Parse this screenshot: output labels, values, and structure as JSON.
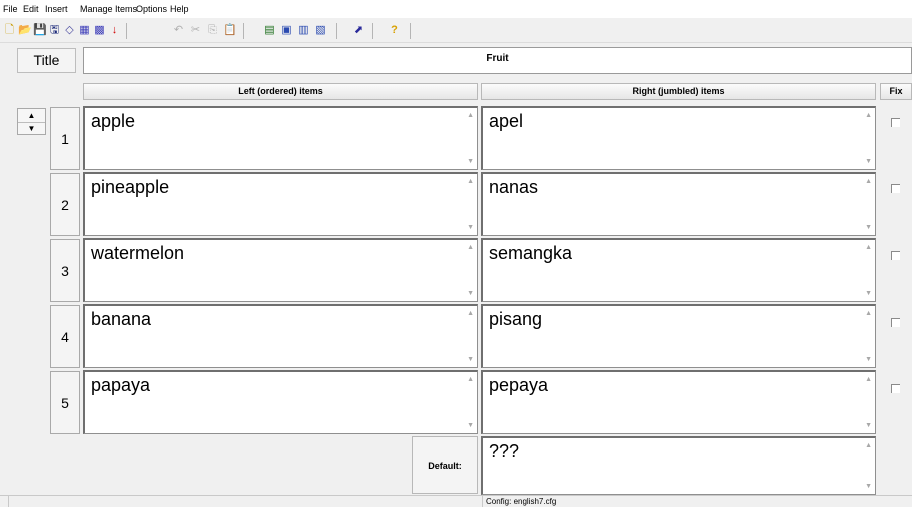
{
  "menu": [
    "File",
    "Edit",
    "Insert",
    "Manage Items",
    "Options",
    "Help"
  ],
  "toolbar_icons": [
    {
      "name": "new-file-icon",
      "glyph": "🗋"
    },
    {
      "name": "open-folder-icon",
      "glyph": "📂"
    },
    {
      "name": "save-icon",
      "glyph": "💾"
    },
    {
      "name": "save-as-icon",
      "glyph": "🖫"
    },
    {
      "name": "eraser-icon",
      "glyph": "◇"
    },
    {
      "name": "shuffle-icon",
      "glyph": "▦"
    },
    {
      "name": "shuffle-all-icon",
      "glyph": "▩"
    },
    {
      "name": "move-down-icon",
      "glyph": "↓"
    },
    {
      "name": "undo-icon",
      "glyph": "↶"
    },
    {
      "name": "cut-icon",
      "glyph": "✂"
    },
    {
      "name": "copy-icon",
      "glyph": "⎘"
    },
    {
      "name": "paste-icon",
      "glyph": "📋"
    },
    {
      "name": "add-items-icon",
      "glyph": "▤"
    },
    {
      "name": "clipboard-items-icon",
      "glyph": "▣"
    },
    {
      "name": "split-items-icon",
      "glyph": "▥"
    },
    {
      "name": "join-items-icon",
      "glyph": "▧"
    },
    {
      "name": "export-icon",
      "glyph": "⬈"
    },
    {
      "name": "help-icon",
      "glyph": "?"
    }
  ],
  "title_button": "Title",
  "title_value": "Fruit",
  "headers": {
    "left": "Left (ordered) items",
    "right": "Right (jumbled) items",
    "fix": "Fix"
  },
  "rows": [
    {
      "num": "1",
      "left": "apple",
      "right": "apel",
      "fix": false
    },
    {
      "num": "2",
      "left": "pineapple",
      "right": "nanas",
      "fix": false
    },
    {
      "num": "3",
      "left": "watermelon",
      "right": "semangka",
      "fix": false
    },
    {
      "num": "4",
      "left": "banana",
      "right": "pisang",
      "fix": false
    },
    {
      "num": "5",
      "left": "papaya",
      "right": "pepaya",
      "fix": false
    }
  ],
  "default_label": "Default:",
  "default_value": "???",
  "status": "Config: english7.cfg"
}
